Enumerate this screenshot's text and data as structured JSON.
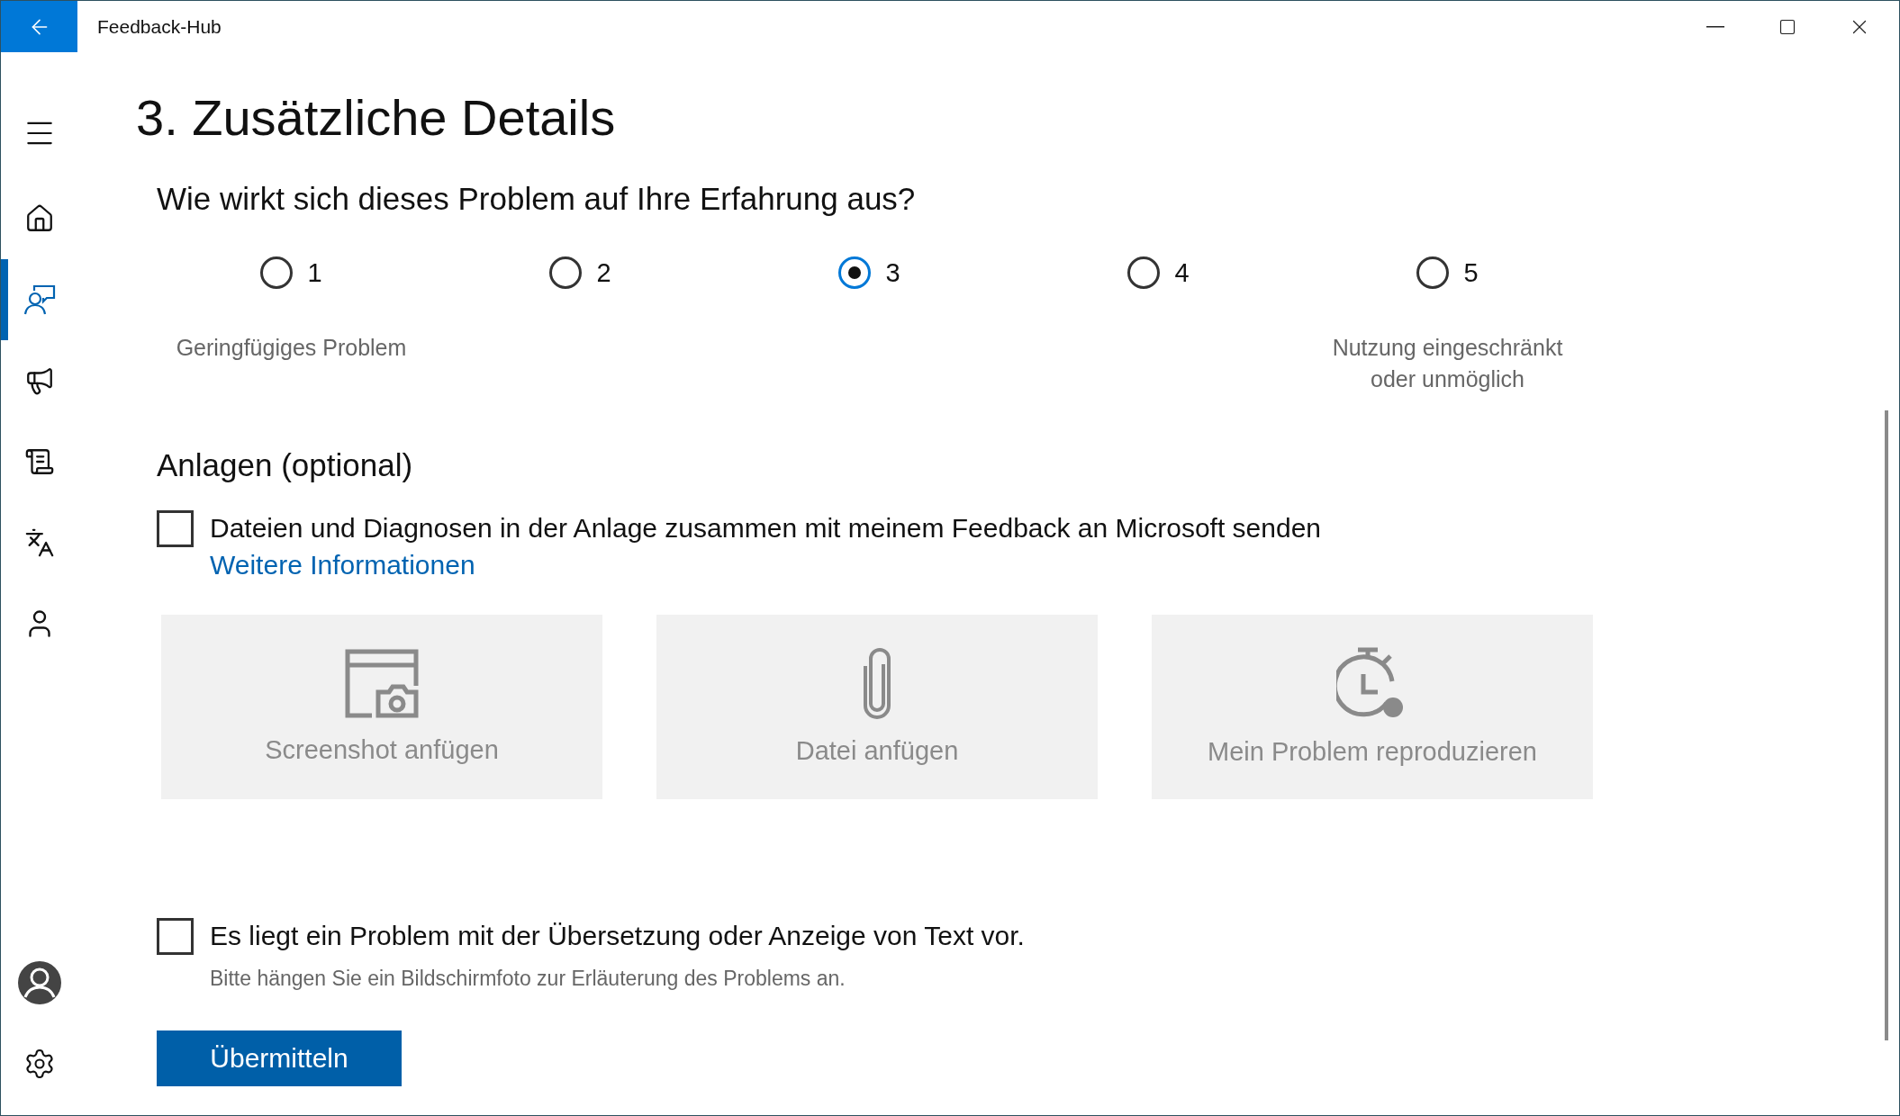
{
  "window": {
    "title": "Feedback-Hub"
  },
  "nav": [
    {
      "selected": false
    },
    {
      "selected": true
    },
    {
      "selected": false
    },
    {
      "selected": false
    },
    {
      "selected": false
    },
    {
      "selected": false
    }
  ],
  "heading": "3. Zusätzliche Details",
  "rating": {
    "question": "Wie wirkt sich dieses Problem auf Ihre Erfahrung aus?",
    "options": [
      {
        "label": "1",
        "selected": false,
        "caption": "Geringfügiges Problem"
      },
      {
        "label": "2",
        "selected": false
      },
      {
        "label": "3",
        "selected": true
      },
      {
        "label": "4",
        "selected": false
      },
      {
        "label": "5",
        "selected": false,
        "caption": "Nutzung eingeschränkt oder unmöglich"
      }
    ]
  },
  "attachments": {
    "title": "Anlagen (optional)",
    "consent": {
      "label": "Dateien und Diagnosen in der Anlage zusammen mit meinem Feedback an Microsoft senden",
      "checked": false,
      "link": "Weitere Informationen"
    },
    "cards": [
      "Screenshot anfügen",
      "Datei anfügen",
      "Mein Problem reproduzieren"
    ]
  },
  "translation": {
    "label": "Es liegt ein Problem mit der Übersetzung oder Anzeige von Text vor.",
    "checked": false,
    "hint": "Bitte hängen Sie ein Bildschirmfoto zur Erläuterung des Problems an."
  },
  "submit": "Übermitteln"
}
